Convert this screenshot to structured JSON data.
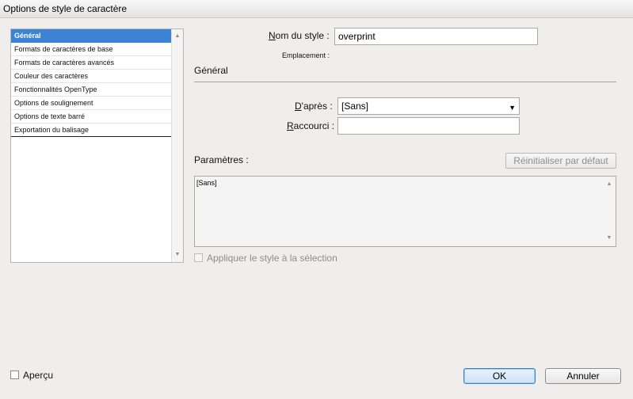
{
  "window": {
    "title": "Options de style de caractère"
  },
  "sidebar": {
    "items": [
      {
        "label": "Général",
        "selected": true
      },
      {
        "label": "Formats de caractères de base",
        "selected": false
      },
      {
        "label": "Formats de caractères avancés",
        "selected": false
      },
      {
        "label": "Couleur des caractères",
        "selected": false
      },
      {
        "label": "Fonctionnalités OpenType",
        "selected": false
      },
      {
        "label": "Options de soulignement",
        "selected": false
      },
      {
        "label": "Options de texte barré",
        "selected": false
      },
      {
        "label": "Exportation du balisage",
        "selected": false
      }
    ]
  },
  "form": {
    "style_name_label_first": "N",
    "style_name_label_rest": "om du style :",
    "style_name_value": "overprint",
    "location_label": "Emplacement :",
    "section_title": "Général",
    "based_on_label_first": "D",
    "based_on_label_rest": "'après :",
    "based_on_value": "[Sans]",
    "shortcut_label_first": "R",
    "shortcut_label_rest": "accourci :",
    "shortcut_value": "",
    "settings_label": "Paramètres :",
    "reset_button": "Réinitialiser par défaut",
    "settings_text": "[Sans]",
    "apply_label": "Appliquer le style à la sélection",
    "apply_checked": false
  },
  "footer": {
    "preview_label": "Aperçu",
    "preview_checked": false,
    "ok_label": "OK",
    "cancel_label": "Annuler"
  },
  "colors": {
    "selection": "#3c83d6",
    "dialog_background": "#efeeec",
    "default_button_border": "#3c7fb1"
  }
}
